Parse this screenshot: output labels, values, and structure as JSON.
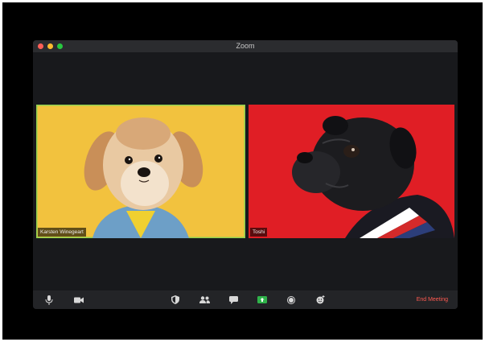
{
  "window": {
    "title": "Zoom"
  },
  "participants": [
    {
      "name": "Karsten Winegeart"
    },
    {
      "name": "Toshi"
    }
  ],
  "toolbar": {
    "icons": [
      "microphone-icon",
      "video-camera-icon",
      "security-shield-icon",
      "participants-icon",
      "chat-icon",
      "share-screen-icon",
      "record-icon",
      "reactions-icon"
    ],
    "end_meeting_label": "End Meeting"
  },
  "colors": {
    "frame": "#000000",
    "window_bg": "#18191c",
    "left_tile_bg": "#f2c23e",
    "right_tile_bg": "#e01e25",
    "active_speaker_border": "#8fd14f",
    "share_accent": "#2fb34a",
    "end_meeting": "#ff5a51"
  }
}
